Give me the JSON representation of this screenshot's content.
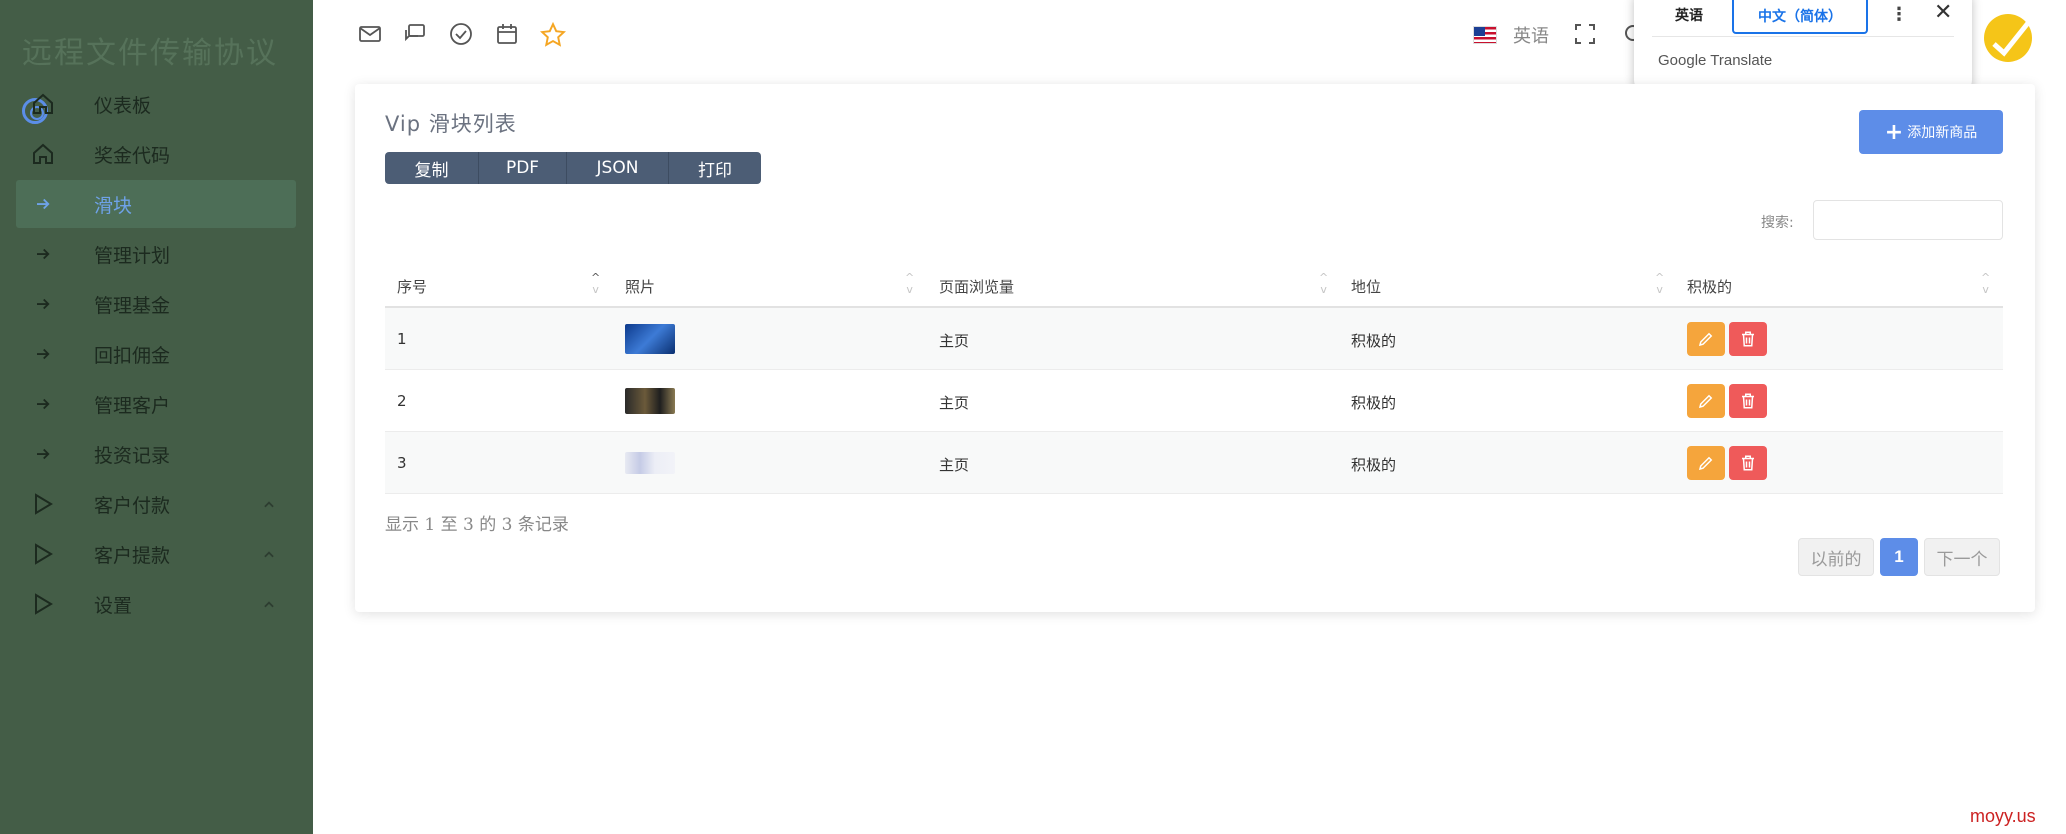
{
  "sidebar": {
    "brand": "远程文件传输协议",
    "items": [
      {
        "label": "仪表板",
        "icon": "home-icon"
      },
      {
        "label": "奖金代码",
        "icon": "home-icon"
      },
      {
        "label": "滑块",
        "icon": "arrow-right-icon",
        "active": true
      },
      {
        "label": "管理计划",
        "icon": "arrow-right-icon"
      },
      {
        "label": "管理基金",
        "icon": "arrow-right-icon"
      },
      {
        "label": "回扣佣金",
        "icon": "arrow-right-icon"
      },
      {
        "label": "管理客户",
        "icon": "arrow-right-icon"
      },
      {
        "label": "投资记录",
        "icon": "arrow-right-icon"
      },
      {
        "label": "客户付款",
        "icon": "play-icon",
        "expandable": true
      },
      {
        "label": "客户提款",
        "icon": "play-icon",
        "expandable": true
      },
      {
        "label": "设置",
        "icon": "play-icon",
        "expandable": true
      }
    ]
  },
  "topbar": {
    "icons": [
      "mail-icon",
      "chat-icon",
      "check-circle-icon",
      "calendar-icon",
      "star-icon"
    ],
    "language": "英语"
  },
  "translate_popup": {
    "tab_source": "英语",
    "tab_target": "中文（简体）",
    "brand": "Google Translate"
  },
  "card": {
    "title": "Vip 滑块列表",
    "export_buttons": [
      "复制",
      "PDF",
      "JSON",
      "打印"
    ],
    "add_button": "添加新商品",
    "search_label": "搜索:",
    "search_value": ""
  },
  "table": {
    "columns": [
      "序号",
      "照片",
      "页面浏览量",
      "地位",
      "积极的"
    ],
    "rows": [
      {
        "index": "1",
        "page": "主页",
        "status": "积极的"
      },
      {
        "index": "2",
        "page": "主页",
        "status": "积极的"
      },
      {
        "index": "3",
        "page": "主页",
        "status": "积极的"
      }
    ]
  },
  "footer": {
    "records": "显示 1 至 3 的 3 条记录",
    "pager": {
      "prev": "以前的",
      "current": "1",
      "next": "下一个"
    }
  },
  "watermark": "moyy.us",
  "colors": {
    "sidebar_bg": "#445d47",
    "accent": "#5d8de8",
    "edit": "#f5a53c",
    "delete": "#ef5a5a",
    "export_bg": "#4c5d75"
  }
}
